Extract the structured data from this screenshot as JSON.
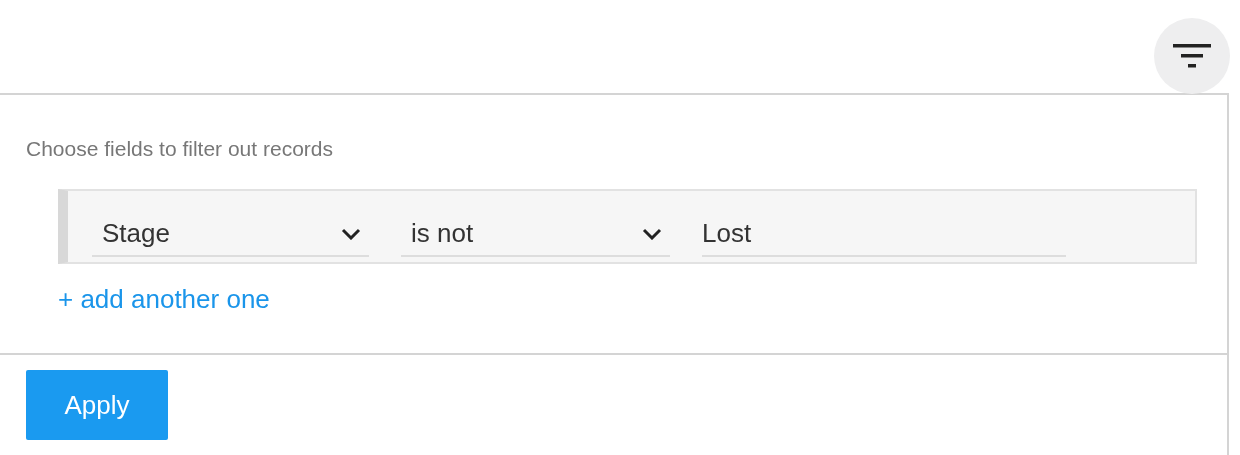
{
  "filter_button": {
    "active": true
  },
  "panel": {
    "hint": "Choose fields to filter out records",
    "conditions": [
      {
        "field": "Stage",
        "operator": "is not",
        "value": "Lost"
      }
    ],
    "add_link": "+ add another one",
    "apply_button": "Apply"
  }
}
